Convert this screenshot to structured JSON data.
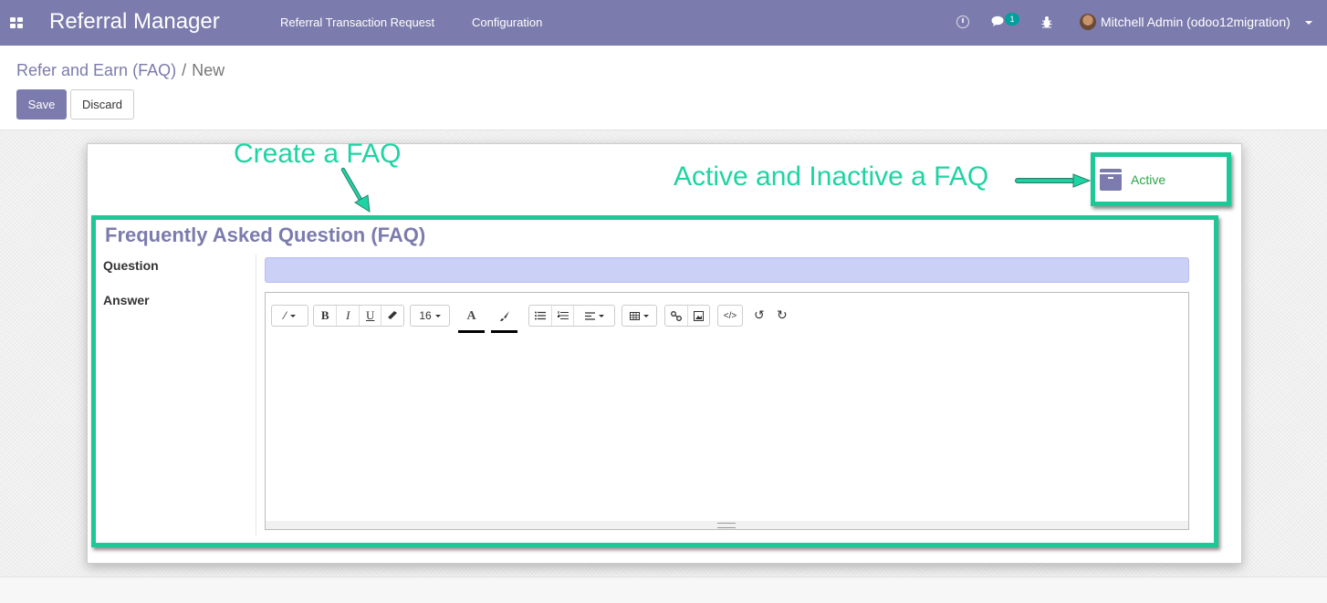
{
  "navbar": {
    "app_title": "Referral Manager",
    "menu": [
      "Referral Transaction Request",
      "Configuration"
    ],
    "messages_count": "1",
    "user_name": "Mitchell Admin (odoo12migration)"
  },
  "control_panel": {
    "breadcrumb_parent": "Refer and Earn (FAQ)",
    "breadcrumb_separator": "/",
    "breadcrumb_current": "New",
    "save_label": "Save",
    "discard_label": "Discard"
  },
  "form": {
    "active_label": "Active",
    "group_title": "Frequently Asked Question (FAQ)",
    "question_label": "Question",
    "question_value": "",
    "answer_label": "Answer",
    "toolbar": {
      "font_size": "16",
      "bold": "B",
      "italic": "I",
      "underline": "U",
      "font_color": "A"
    }
  },
  "annotations": {
    "create": "Create a FAQ",
    "active": "Active and Inactive a FAQ"
  },
  "colors": {
    "navbar": "#7c7bad",
    "primary": "#7c7bad",
    "annotation": "#1ed4a3",
    "question_field": "#cbd0f7",
    "active_text": "#28a745"
  }
}
